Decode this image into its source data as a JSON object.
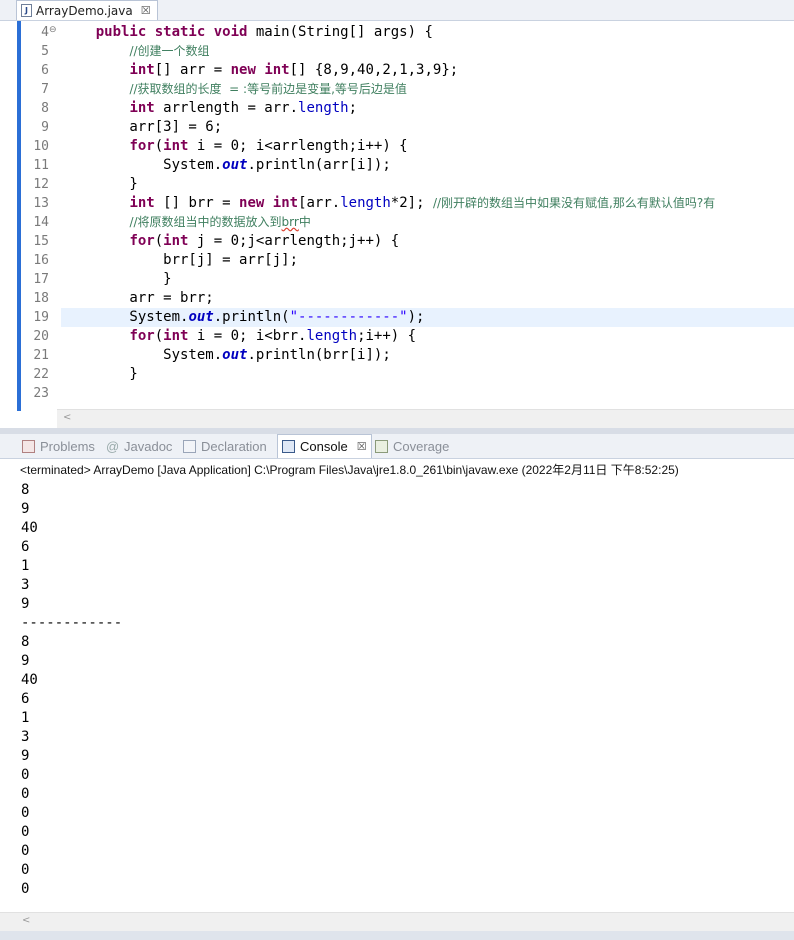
{
  "editor": {
    "tab_title": "ArrayDemo.java",
    "tab_icon": "java-file-icon",
    "close_glyph": "☒",
    "lines": [
      {
        "n": "4",
        "tokens": [
          [
            "p",
            "    "
          ],
          [
            "kw",
            "public static void"
          ],
          [
            "p",
            " main(String[] args) {"
          ]
        ]
      },
      {
        "n": "5",
        "tokens": [
          [
            "p",
            "        "
          ],
          [
            "cm",
            "//创建一个数组"
          ]
        ]
      },
      {
        "n": "6",
        "tokens": [
          [
            "p",
            "        "
          ],
          [
            "kw",
            "int"
          ],
          [
            "p",
            "[] arr = "
          ],
          [
            "kw",
            "new"
          ],
          [
            "p",
            " "
          ],
          [
            "kw",
            "int"
          ],
          [
            "p",
            "[] {8,9,40,2,1,3,9};"
          ]
        ]
      },
      {
        "n": "7",
        "tokens": [
          [
            "p",
            "        "
          ],
          [
            "cm",
            "//获取数组的长度  = :等号前边是变量,等号后边是值"
          ]
        ]
      },
      {
        "n": "8",
        "tokens": [
          [
            "p",
            "        "
          ],
          [
            "kw",
            "int"
          ],
          [
            "p",
            " arrlength = arr."
          ],
          [
            "fld",
            "length"
          ],
          [
            "p",
            ";"
          ]
        ]
      },
      {
        "n": "9",
        "tokens": [
          [
            "p",
            "        arr[3] = 6;"
          ]
        ]
      },
      {
        "n": "10",
        "tokens": [
          [
            "p",
            "        "
          ],
          [
            "kw",
            "for"
          ],
          [
            "p",
            "("
          ],
          [
            "kw",
            "int"
          ],
          [
            "p",
            " i = 0; i<arrlength;i++) {"
          ]
        ]
      },
      {
        "n": "11",
        "tokens": [
          [
            "p",
            "            System."
          ],
          [
            "sfld",
            "out"
          ],
          [
            "p",
            ".println(arr[i]);"
          ]
        ]
      },
      {
        "n": "12",
        "tokens": [
          [
            "p",
            "        }"
          ]
        ]
      },
      {
        "n": "13",
        "tokens": [
          [
            "p",
            "        "
          ],
          [
            "kw",
            "int"
          ],
          [
            "p",
            " [] brr = "
          ],
          [
            "kw",
            "new"
          ],
          [
            "p",
            " "
          ],
          [
            "kw",
            "int"
          ],
          [
            "p",
            "[arr."
          ],
          [
            "fld",
            "length"
          ],
          [
            "p",
            "*2]; "
          ],
          [
            "cm",
            "//刚开辟的数组当中如果没有赋值,那么有默认值吗?有"
          ]
        ]
      },
      {
        "n": "14",
        "tokens": [
          [
            "p",
            "        "
          ],
          [
            "cm",
            "//将原数组当中的数据放入到"
          ],
          [
            "cmsq",
            "brr"
          ],
          [
            "cm",
            "中"
          ]
        ]
      },
      {
        "n": "15",
        "tokens": [
          [
            "p",
            "        "
          ],
          [
            "kw",
            "for"
          ],
          [
            "p",
            "("
          ],
          [
            "kw",
            "int"
          ],
          [
            "p",
            " j = 0;j<arrlength;j++) {"
          ]
        ]
      },
      {
        "n": "16",
        "tokens": [
          [
            "p",
            "            brr[j] = arr[j];"
          ]
        ]
      },
      {
        "n": "17",
        "tokens": [
          [
            "p",
            "            }"
          ]
        ]
      },
      {
        "n": "18",
        "tokens": [
          [
            "p",
            "        arr = brr;"
          ]
        ]
      },
      {
        "n": "19",
        "tokens": [
          [
            "p",
            "        System."
          ],
          [
            "sfld",
            "out"
          ],
          [
            "p",
            ".println("
          ],
          [
            "str",
            "\"------------\""
          ],
          [
            "p",
            ");"
          ]
        ]
      },
      {
        "n": "20",
        "tokens": [
          [
            "p",
            "        "
          ],
          [
            "kw",
            "for"
          ],
          [
            "p",
            "("
          ],
          [
            "kw",
            "int"
          ],
          [
            "p",
            " i = 0; i<brr."
          ],
          [
            "fld",
            "length"
          ],
          [
            "p",
            ";i++) {"
          ]
        ]
      },
      {
        "n": "21",
        "tokens": [
          [
            "p",
            "            System."
          ],
          [
            "sfld",
            "out"
          ],
          [
            "p",
            ".println(brr[i]);"
          ]
        ]
      },
      {
        "n": "22",
        "tokens": [
          [
            "p",
            "        }"
          ]
        ]
      },
      {
        "n": "23",
        "tokens": []
      }
    ],
    "current_line": "19",
    "fold_line": "4",
    "fold_glyph": "⊖"
  },
  "views": {
    "tabs": [
      {
        "label": "Problems",
        "icon": "problems-icon",
        "active": false
      },
      {
        "label": "Javadoc",
        "icon": "javadoc-icon",
        "active": false
      },
      {
        "label": "Declaration",
        "icon": "declaration-icon",
        "active": false
      },
      {
        "label": "Console",
        "icon": "console-icon",
        "active": true
      },
      {
        "label": "Coverage",
        "icon": "coverage-icon",
        "active": false
      }
    ],
    "javadoc_glyph": "@",
    "close_glyph": "☒"
  },
  "console": {
    "status": "<terminated> ArrayDemo [Java Application] C:\\Program Files\\Java\\jre1.8.0_261\\bin\\javaw.exe (2022年2月11日 下午8:52:25)",
    "output": [
      "8",
      "9",
      "40",
      "6",
      "1",
      "3",
      "9",
      "------------",
      "8",
      "9",
      "40",
      "6",
      "1",
      "3",
      "9",
      "0",
      "0",
      "0",
      "0",
      "0",
      "0",
      "0"
    ]
  },
  "scroll_arrow": "<"
}
